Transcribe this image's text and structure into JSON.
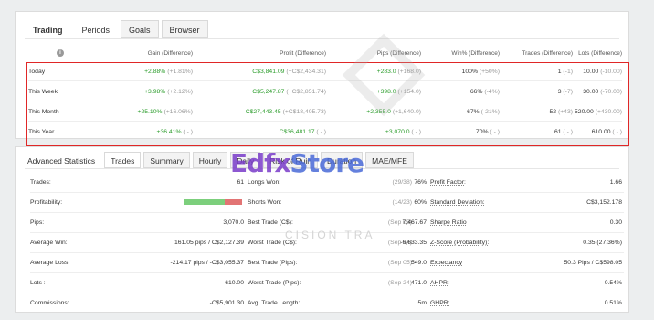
{
  "tabs": [
    "Trading",
    "Periods",
    "Goals",
    "Browser"
  ],
  "perf": {
    "headers": [
      "Gain (Difference)",
      "Profit (Difference)",
      "Pips (Difference)",
      "Win% (Difference)",
      "Trades (Difference)",
      "Lots (Difference)"
    ],
    "rows": [
      {
        "period": "Today",
        "gain": "+2.88%",
        "gain_d": "(+1.81%)",
        "profit": "C$3,841.09",
        "profit_d": "(+C$2,434.31)",
        "pips": "+283.0",
        "pips_d": "(+168.0)",
        "win": "100%",
        "win_d": "(+50%)",
        "trades": "1",
        "trades_d": "(-1)",
        "lots": "10.00",
        "lots_d": "(-10.00)"
      },
      {
        "period": "This Week",
        "gain": "+3.98%",
        "gain_d": "(+2.12%)",
        "profit": "C$5,247.87",
        "profit_d": "(+C$2,851.74)",
        "pips": "+398.0",
        "pips_d": "(+154.0)",
        "win": "66%",
        "win_d": "(-4%)",
        "trades": "3",
        "trades_d": "(-7)",
        "lots": "30.00",
        "lots_d": "(-70.00)"
      },
      {
        "period": "This Month",
        "gain": "+25.10%",
        "gain_d": "(+16.06%)",
        "profit": "C$27,443.45",
        "profit_d": "(+C$18,405.73)",
        "pips": "+2,355.0",
        "pips_d": "(+1,640.0)",
        "win": "67%",
        "win_d": "(-21%)",
        "trades": "52",
        "trades_d": "(+43)",
        "lots": "520.00",
        "lots_d": "(+430.00)"
      },
      {
        "period": "This Year",
        "gain": "+36.41%",
        "gain_d": "( - )",
        "profit": "C$36,481.17",
        "profit_d": "( - )",
        "pips": "+3,070.0",
        "pips_d": "( - )",
        "win": "70%",
        "win_d": "( - )",
        "trades": "61",
        "trades_d": "( - )",
        "lots": "610.00",
        "lots_d": "( - )"
      }
    ]
  },
  "stat_tabs": [
    "Advanced Statistics",
    "Trades",
    "Summary",
    "Hourly",
    "Daily",
    "Risk of Ruin",
    "Duration",
    "MAE/MFE"
  ],
  "stats": [
    {
      "l1": "Trades:",
      "v1": "61",
      "l2": "Longs Won:",
      "p2": "(29/38)",
      "v2": "76%",
      "l3": "Profit Factor:",
      "v3": "1.66"
    },
    {
      "l1": "Profitability:",
      "v1": "",
      "l2": "Shorts Won:",
      "p2": "(14/23)",
      "v2": "60%",
      "l3": "Standard Deviation:",
      "v3": "C$3,152.178"
    },
    {
      "l1": "Pips:",
      "v1": "3,070.0",
      "l2": "Best Trade (C$):",
      "p2": "(Sep 05)",
      "v2": "7,467.67",
      "l3": "Sharpe Ratio",
      "v3": "0.30"
    },
    {
      "l1": "Average Win:",
      "v1": "161.05 pips / C$2,127.39",
      "l2": "Worst Trade (C$):",
      "p2": "(Sep 24)",
      "v2": "-6,633.35",
      "l3": "Z-Score (Probability):",
      "v3": "0.35 (27.36%)"
    },
    {
      "l1": "Average Loss:",
      "v1": "-214.17 pips / -C$3,055.37",
      "l2": "Best Trade (Pips):",
      "p2": "(Sep 05)",
      "v2": "549.0",
      "l3": "Expectancy",
      "v3": "50.3 Pips / C$598.05"
    },
    {
      "l1": "Lots :",
      "v1": "610.00",
      "l2": "Worst Trade (Pips):",
      "p2": "(Sep 24)",
      "v2": "-471.0",
      "l3": "AHPR:",
      "v3": "0.54%"
    },
    {
      "l1": "Commissions:",
      "v1": "-C$5,901.30",
      "l2": "Avg. Trade Length:",
      "p2": "",
      "v2": "5m",
      "l3": "GHPR:",
      "v3": "0.51%"
    }
  ],
  "profitability_win_fraction": 0.7,
  "watermark": {
    "brand_a": "Edfx",
    "brand_b": "Store",
    "sub": "CISION TRA"
  },
  "colors": {
    "gain": "#2b9c2b",
    "highlight_border": "#e02727",
    "win_bar": "#7ccf7c",
    "loss_bar": "#e27474"
  }
}
